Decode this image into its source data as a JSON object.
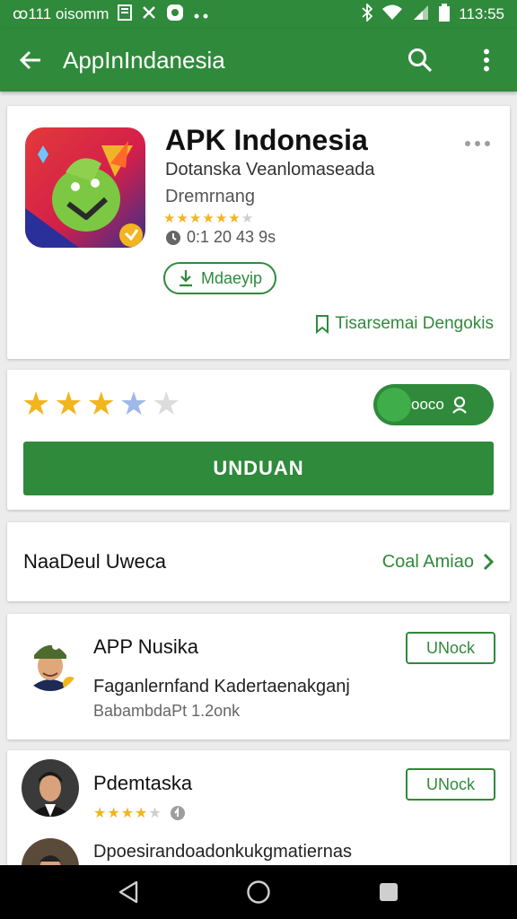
{
  "status_bar": {
    "left_text": "ꝏ111 oisomm",
    "time": "113:55"
  },
  "app_bar": {
    "title": "AppInIndanesia",
    "back_icon": "arrow-left-icon",
    "search_icon": "search-icon",
    "menu_icon": "vertical-dots-icon"
  },
  "app_header": {
    "title": "APK Indonesia",
    "developer": "Dotanska Veanlomaseada",
    "category": "Dremrnang",
    "rating_stars": 4.5,
    "size_text": "0:1 20 43 9s",
    "pill_button_label": "Mdaeyip",
    "wishlist_label": "Tisarsemai Dengokis"
  },
  "rating_card": {
    "stars": 3.5,
    "toggle_label": "ooco",
    "download_label": "UNDUAN"
  },
  "similar_section": {
    "title": "NaaDeul Uweca",
    "more_label": "Coal Amiao"
  },
  "items": [
    {
      "name": "APP Nusika",
      "description": "Faganlernfand Kadertaenakganj",
      "sub": "BabambdaPt 1.2onk",
      "button_label": "UNock"
    },
    {
      "name": "Pdemtaska",
      "button_label": "UNock",
      "rating_stars": 4
    }
  ],
  "third_item_peek": "Dpoesirandoadonkukgmatiernas",
  "colors": {
    "brand_green": "#2f8a3b",
    "star_yellow": "#f2b51f"
  }
}
